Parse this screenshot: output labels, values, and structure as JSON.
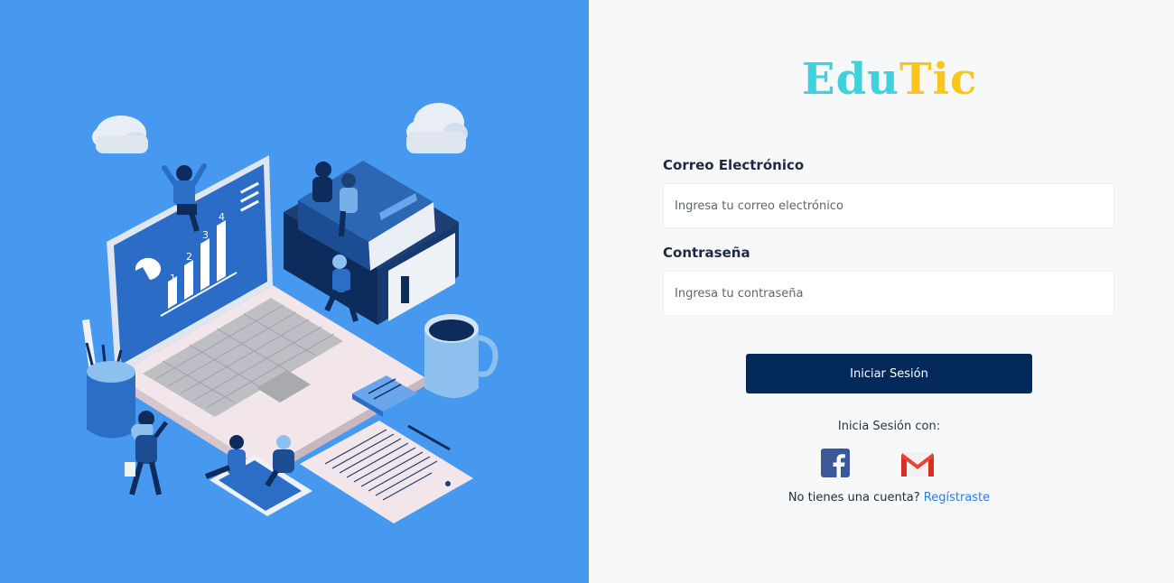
{
  "brand": {
    "part1": "Edu",
    "part2": "Tic",
    "color1": "#3fd2dd",
    "color2": "#f9c619"
  },
  "form": {
    "email_label": "Correo Electrónico",
    "email_placeholder": "Ingresa tu correo electrónico",
    "password_label": "Contraseña",
    "password_placeholder": "Ingresa tu contraseña",
    "submit_label": "Iniciar Sesión"
  },
  "social": {
    "caption": "Inicia Sesión con:",
    "providers": [
      {
        "name": "Facebook",
        "icon": "facebook-icon"
      },
      {
        "name": "Gmail",
        "icon": "gmail-icon"
      }
    ]
  },
  "register": {
    "prompt": "No tienes una cuenta?",
    "link_label": "Regístraste"
  },
  "illustration": {
    "chart_labels": [
      "1",
      "2",
      "3",
      "4"
    ],
    "colors": {
      "background": "#4699ee",
      "primary_dark": "#02295a",
      "accent": "#2a7de1"
    }
  }
}
